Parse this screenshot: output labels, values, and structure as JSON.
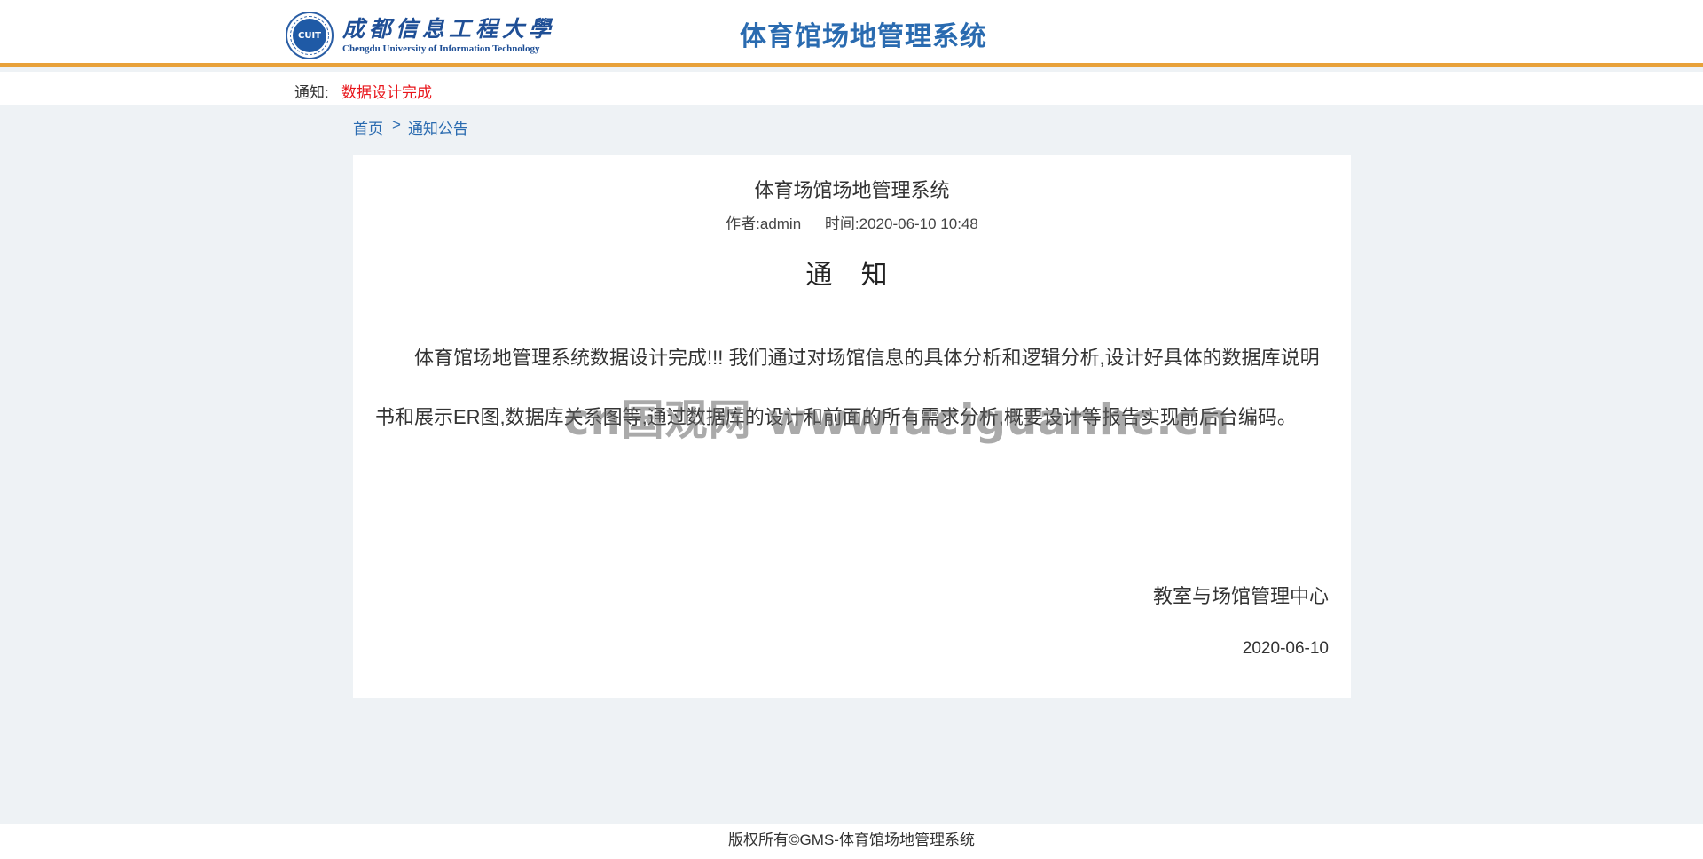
{
  "header": {
    "logo": {
      "seal_text": "CUIT",
      "name_cn": "成都信息工程大學",
      "name_en": "Chengdu University of Information Technology"
    },
    "system_title": "体育馆场地管理系统",
    "accent_color": "#e8a13a",
    "title_color": "#2a6bb0"
  },
  "notice_bar": {
    "label": "通知:",
    "text": "数据设计完成",
    "text_color": "#e8151b"
  },
  "breadcrumb": {
    "home": "首页",
    "separator": ">",
    "current": "通知公告"
  },
  "article": {
    "title": "体育场馆场地管理系统",
    "author": "作者:admin",
    "time": "时间:2020-06-10 10:48",
    "heading": "通 知",
    "body": "体育馆场地管理系统数据设计完成!!! 我们通过对场馆信息的具体分析和逻辑分析,设计好具体的数据库说明书和展示ER图,数据库关系图等,通过数据库的设计和前面的所有需求分析,概要设计等报告实现前后台编码。",
    "signature": "教室与场馆管理中心",
    "date": "2020-06-10"
  },
  "watermark": "cn国观网 www.uciguanhc.cn",
  "footer": {
    "copyright": "版权所有©GMS-体育馆场地管理系统"
  }
}
